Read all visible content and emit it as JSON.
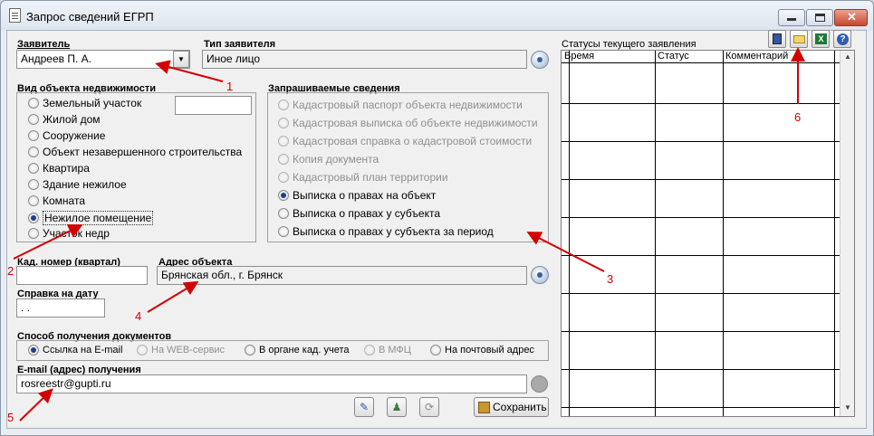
{
  "window": {
    "title": "Запрос сведений ЕГРП"
  },
  "applicant": {
    "label": "Заявитель",
    "value": "Андреев П. А."
  },
  "applicant_type": {
    "label": "Тип заявителя",
    "value": "Иное лицо"
  },
  "object_type": {
    "label": "Вид объекта недвижимости",
    "options": [
      "Земельный участок",
      "Жилой дом",
      "Сооружение",
      "Объект незавершенного строительства",
      "Квартира",
      "Здание нежилое",
      "Комната",
      "Нежилое помещение",
      "Участок недр"
    ],
    "selected": "Нежилое помещение"
  },
  "requested_info": {
    "label": "Запрашиваемые сведения",
    "options": [
      "Кадастровый паспорт объекта недвижимости",
      "Кадастровая выписка об объекте недвижимости",
      "Кадастровая справка о кадастровой стоимости",
      "Копия документа",
      "Кадастровый план территории",
      "Выписка о правах на объект",
      "Выписка о правах у субъекта",
      "Выписка о правах у субъекта за период"
    ],
    "selected": "Выписка о правах на объект"
  },
  "cad_number": {
    "label": "Кад. номер (квартал)",
    "value": ""
  },
  "address": {
    "label": "Адрес объекта",
    "value": "Брянская обл., г. Брянск"
  },
  "date_ref": {
    "label": "Справка на дату",
    "value": " .  ."
  },
  "delivery": {
    "label": "Способ получения документов",
    "options": [
      "Ссылка на E-mail",
      "На WEB-сервис",
      "В органе кад. учета",
      "В МФЦ",
      "На почтовый адрес"
    ],
    "selected": "Ссылка на E-mail"
  },
  "email": {
    "label": "E-mail (адрес) получения",
    "value": "rosreestr@gupti.ru"
  },
  "save_button": {
    "label": "Сохранить"
  },
  "statuses": {
    "label": "Статусы текущего заявления",
    "columns": [
      "Время",
      "Статус",
      "Комментарий"
    ]
  },
  "annotations": [
    "1",
    "2",
    "3",
    "4",
    "5",
    "6"
  ],
  "colors": {
    "annotation": "#d40000",
    "accent": "#1f3f8a"
  }
}
